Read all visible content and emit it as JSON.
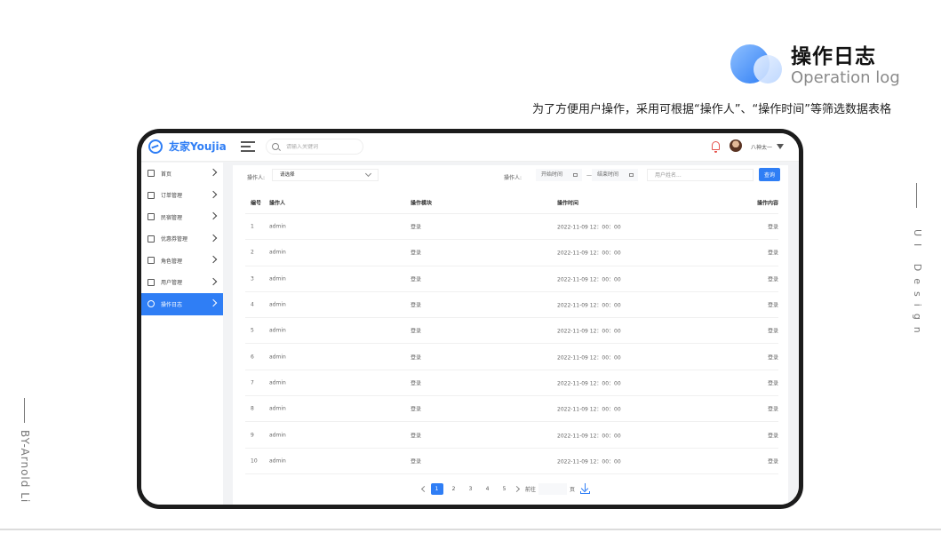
{
  "heading": {
    "title_cn": "操作日志",
    "title_en": "Operation log",
    "description": "为了方便用户操作，采用可根据“操作人”、“操作时间”等筛选数据表格"
  },
  "side_right_text": "UI Design",
  "side_left_text": "BY-Arnold Li",
  "colors": {
    "primary": "#2f7ef5",
    "notify": "#e6554f",
    "frame": "#1c1c1c"
  },
  "app": {
    "brand": "友家Youjia",
    "search_placeholder": "请输入关键词",
    "user_name": "八神太一"
  },
  "sidebar": {
    "items": [
      {
        "label": "首页",
        "icon": "home-icon"
      },
      {
        "label": "订单管理",
        "icon": "order-icon"
      },
      {
        "label": "民宿管理",
        "icon": "building-icon"
      },
      {
        "label": "优惠券管理",
        "icon": "coupon-icon"
      },
      {
        "label": "角色管理",
        "icon": "role-icon"
      },
      {
        "label": "用户管理",
        "icon": "user-icon"
      },
      {
        "label": "操作日志",
        "icon": "gear-icon",
        "active": true
      }
    ]
  },
  "filters": {
    "operator_label": "操作人:",
    "operator_select": "请选择",
    "time_label": "操作人:",
    "start_date": "开始时间",
    "dash": "—",
    "end_date": "结束时间",
    "name_placeholder": "用户姓名...",
    "query_button": "查询"
  },
  "table": {
    "headers": {
      "id": "编号",
      "operator": "操作人",
      "module": "操作模块",
      "time": "操作时间",
      "content": "操作内容"
    },
    "rows": [
      {
        "id": "1",
        "operator": "admin",
        "module": "登录",
        "time": "2022-11-09 12：00：00",
        "content": "登录"
      },
      {
        "id": "2",
        "operator": "admin",
        "module": "登录",
        "time": "2022-11-09 12：00：00",
        "content": "登录"
      },
      {
        "id": "3",
        "operator": "admin",
        "module": "登录",
        "time": "2022-11-09 12：00：00",
        "content": "登录"
      },
      {
        "id": "4",
        "operator": "admin",
        "module": "登录",
        "time": "2022-11-09 12：00：00",
        "content": "登录"
      },
      {
        "id": "5",
        "operator": "admin",
        "module": "登录",
        "time": "2022-11-09 12：00：00",
        "content": "登录"
      },
      {
        "id": "6",
        "operator": "admin",
        "module": "登录",
        "time": "2022-11-09 12：00：00",
        "content": "登录"
      },
      {
        "id": "7",
        "operator": "admin",
        "module": "登录",
        "time": "2022-11-09 12：00：00",
        "content": "登录"
      },
      {
        "id": "8",
        "operator": "admin",
        "module": "登录",
        "time": "2022-11-09 12：00：00",
        "content": "登录"
      },
      {
        "id": "9",
        "operator": "admin",
        "module": "登录",
        "time": "2022-11-09 12：00：00",
        "content": "登录"
      },
      {
        "id": "10",
        "operator": "admin",
        "module": "登录",
        "time": "2022-11-09 12：00：00",
        "content": "登录"
      }
    ]
  },
  "pagination": {
    "pages": [
      "1",
      "2",
      "3",
      "4",
      "5"
    ],
    "current": "1",
    "goto_label": "前往",
    "page_label": "页"
  }
}
